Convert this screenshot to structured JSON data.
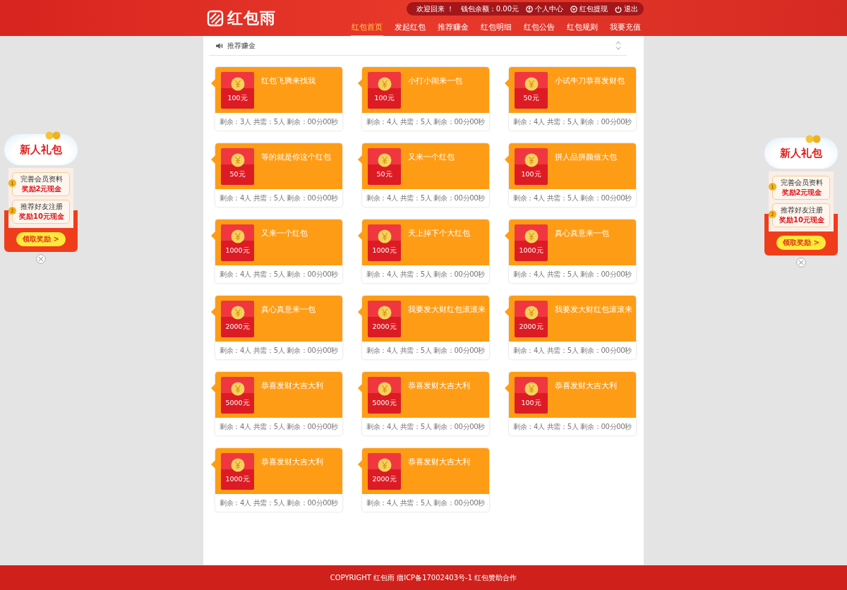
{
  "header": {
    "logo": "红包雨",
    "user_bar": [
      {
        "kind": "text",
        "label": "欢迎回来 ！"
      },
      {
        "kind": "text",
        "label": "钱包余额：0.00元"
      },
      {
        "kind": "user",
        "label": "个人中心"
      },
      {
        "kind": "withdraw",
        "label": "红包提现"
      },
      {
        "kind": "power",
        "label": "退出"
      }
    ],
    "nav": [
      {
        "label": "红包首页",
        "selected": true
      },
      {
        "label": "发起红包",
        "selected": false
      },
      {
        "label": "推荐赚金",
        "selected": false
      },
      {
        "label": "红包明细",
        "selected": false
      },
      {
        "label": "红包公告",
        "selected": false
      },
      {
        "label": "红包规则",
        "selected": false
      },
      {
        "label": "我要充值",
        "selected": false
      }
    ]
  },
  "notice": {
    "text": "推荐赚金"
  },
  "packets": [
    {
      "title": "红包飞腾来找我",
      "amount": "100元",
      "stats": "剩余：3人 共需：5人 剩余：00分00秒"
    },
    {
      "title": "小打小闹来一包",
      "amount": "100元",
      "stats": "剩余：4人 共需：5人 剩余：00分00秒"
    },
    {
      "title": "小试牛刀恭喜发财包",
      "amount": "50元",
      "stats": "剩余：4人 共需：5人 剩余：00分00秒"
    },
    {
      "title": "等的就是你这个红包",
      "amount": "50元",
      "stats": "剩余：4人 共需：5人 剩余：00分00秒"
    },
    {
      "title": "又来一个红包",
      "amount": "50元",
      "stats": "剩余：4人 共需：5人 剩余：00分00秒"
    },
    {
      "title": "拼人品拼颜值大包",
      "amount": "100元",
      "stats": "剩余：4人 共需：5人 剩余：00分00秒"
    },
    {
      "title": "又来一个红包",
      "amount": "1000元",
      "stats": "剩余：4人 共需：5人 剩余：00分00秒"
    },
    {
      "title": "天上掉下个大红包",
      "amount": "1000元",
      "stats": "剩余：4人 共需：5人 剩余：00分00秒"
    },
    {
      "title": "真心真意来一包",
      "amount": "1000元",
      "stats": "剩余：4人 共需：5人 剩余：00分00秒"
    },
    {
      "title": "真心真意来一包",
      "amount": "2000元",
      "stats": "剩余：4人 共需：5人 剩余：00分00秒"
    },
    {
      "title": "我要发大财红包滚滚来",
      "amount": "2000元",
      "stats": "剩余：4人 共需：5人 剩余：00分00秒"
    },
    {
      "title": "我要发大财红包滚滚来",
      "amount": "2000元",
      "stats": "剩余：4人 共需：5人 剩余：00分00秒"
    },
    {
      "title": "恭喜发财大吉大利",
      "amount": "5000元",
      "stats": "剩余：4人 共需：5人 剩余：00分00秒"
    },
    {
      "title": "恭喜发财大吉大利",
      "amount": "5000元",
      "stats": "剩余：4人 共需：5人 剩余：00分00秒"
    },
    {
      "title": "恭喜发财大吉大利",
      "amount": "100元",
      "stats": "剩余：4人 共需：5人 剩余：00分00秒"
    },
    {
      "title": "恭喜发财大吉大利",
      "amount": "1000元",
      "stats": "剩余：4人 共需：5人 剩余：00分00秒"
    },
    {
      "title": "恭喜发财大吉大利",
      "amount": "2000元",
      "stats": "剩余：4人 共需：5人 剩余：00分00秒"
    }
  ],
  "side_ads": [
    {
      "title": "新人礼包",
      "tasks": [
        {
          "number": "1",
          "label": "完善会员资料",
          "reward": "奖励2元现金"
        },
        {
          "number": "2",
          "label": "推荐好友注册",
          "reward": "奖励10元现金"
        }
      ],
      "button": "领取奖励 >"
    },
    {
      "title": "新人礼包",
      "tasks": [
        {
          "number": "1",
          "label": "完善会员资料",
          "reward": "奖励2元现金"
        },
        {
          "number": "2",
          "label": "推荐好友注册",
          "reward": "奖励10元现金"
        }
      ],
      "button": "领取奖励 >"
    }
  ],
  "footer": {
    "text": "COPYRIGHT 红包雨 痼ICP备17002403号-1 红包赞助合作"
  }
}
